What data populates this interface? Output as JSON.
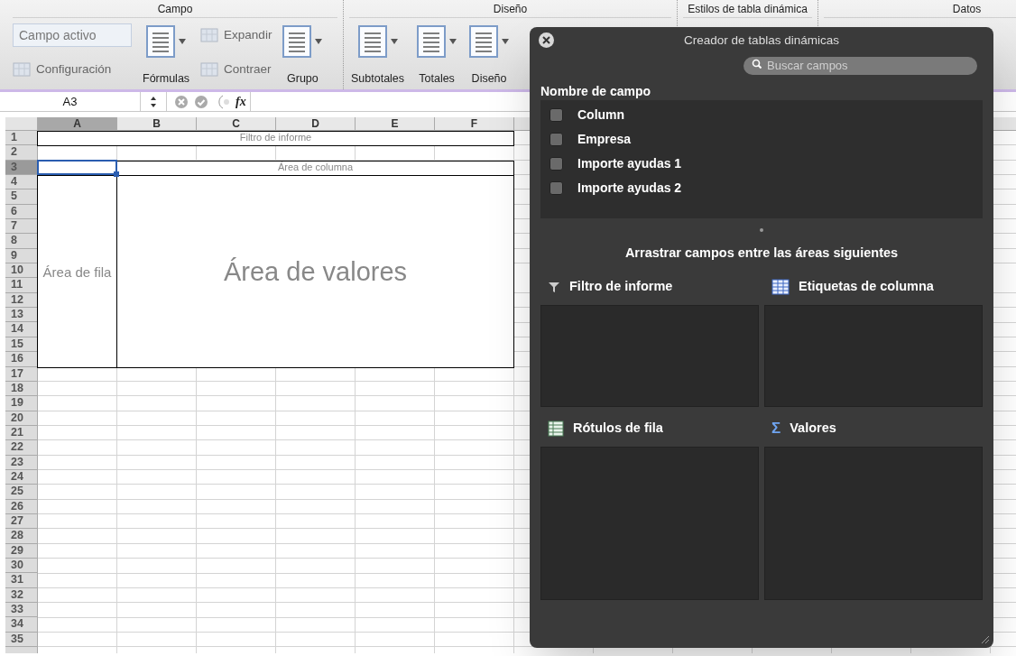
{
  "ribbon": {
    "groups": [
      {
        "title": "Campo",
        "items": [
          {
            "kind": "stack",
            "items": [
              {
                "kind": "field",
                "value": "Campo activo"
              },
              {
                "kind": "small",
                "label": "Configuración",
                "disabled": true
              }
            ]
          },
          {
            "kind": "large",
            "label": "Fórmulas",
            "dropdown": true
          },
          {
            "kind": "stack",
            "items": [
              {
                "kind": "small",
                "label": "Expandir",
                "disabled": true
              },
              {
                "kind": "small",
                "label": "Contraer",
                "disabled": true
              }
            ]
          },
          {
            "kind": "large",
            "label": "Grupo",
            "dropdown": true
          }
        ]
      },
      {
        "title": "Diseño",
        "items": [
          {
            "kind": "large",
            "label": "Subtotales",
            "dropdown": true
          },
          {
            "kind": "large",
            "label": "Totales",
            "dropdown": true
          },
          {
            "kind": "large",
            "label": "Diseño",
            "dropdown": true
          }
        ]
      },
      {
        "title": "Estilos de tabla dinámica"
      },
      {
        "title": "Datos"
      }
    ]
  },
  "formula_bar": {
    "name_box": "A3",
    "fx": "fx"
  },
  "sheet": {
    "columns": [
      {
        "label": "A",
        "selected": true
      },
      {
        "label": "B",
        "selected": false
      },
      {
        "label": "C",
        "selected": false
      },
      {
        "label": "D",
        "selected": false
      },
      {
        "label": "E",
        "selected": false
      },
      {
        "label": "F",
        "selected": false
      }
    ],
    "rows": [
      {
        "label": "1",
        "selected": false
      },
      {
        "label": "2",
        "selected": false
      },
      {
        "label": "3",
        "selected": true
      },
      {
        "label": "4",
        "selected": false
      },
      {
        "label": "5",
        "selected": false
      },
      {
        "label": "6",
        "selected": false
      },
      {
        "label": "7",
        "selected": false
      },
      {
        "label": "8",
        "selected": false
      },
      {
        "label": "9",
        "selected": false
      },
      {
        "label": "10",
        "selected": false
      },
      {
        "label": "11",
        "selected": false
      },
      {
        "label": "12",
        "selected": false
      },
      {
        "label": "13",
        "selected": false
      },
      {
        "label": "14",
        "selected": false
      },
      {
        "label": "15",
        "selected": false
      },
      {
        "label": "16",
        "selected": false
      },
      {
        "label": "17",
        "selected": false
      },
      {
        "label": "18",
        "selected": false
      },
      {
        "label": "19",
        "selected": false
      },
      {
        "label": "20",
        "selected": false
      },
      {
        "label": "21",
        "selected": false
      },
      {
        "label": "22",
        "selected": false
      },
      {
        "label": "23",
        "selected": false
      },
      {
        "label": "24",
        "selected": false
      },
      {
        "label": "25",
        "selected": false
      },
      {
        "label": "26",
        "selected": false
      },
      {
        "label": "27",
        "selected": false
      },
      {
        "label": "28",
        "selected": false
      },
      {
        "label": "29",
        "selected": false
      },
      {
        "label": "30",
        "selected": false
      },
      {
        "label": "31",
        "selected": false
      },
      {
        "label": "32",
        "selected": false
      },
      {
        "label": "33",
        "selected": false
      },
      {
        "label": "34",
        "selected": false
      },
      {
        "label": "35",
        "selected": false
      }
    ],
    "regions": [
      {
        "kind": "filter",
        "text": "Filtro de informe"
      },
      {
        "kind": "column",
        "text": "Área de columna"
      },
      {
        "kind": "row",
        "text": "Área de fila"
      },
      {
        "kind": "values",
        "text": "Área de valores"
      }
    ]
  },
  "pivot_builder": {
    "title": "Creador de tablas dinámicas",
    "search": {
      "placeholder": "Buscar campos"
    },
    "fields_heading": "Nombre de campo",
    "fields": [
      {
        "label": "Column",
        "checked": false
      },
      {
        "label": "Empresa",
        "checked": false
      },
      {
        "label": "Importe ayudas 1",
        "checked": false
      },
      {
        "label": "Importe ayudas 2",
        "checked": false
      }
    ],
    "instruction": "Arrastrar campos entre las áreas siguientes",
    "areas": [
      {
        "kind": "filter",
        "label": "Filtro de informe"
      },
      {
        "kind": "columns",
        "label": "Etiquetas de columna"
      },
      {
        "kind": "rows",
        "label": "Rótulos de fila"
      },
      {
        "kind": "values",
        "label": "Valores",
        "symbol": "Σ"
      }
    ]
  }
}
